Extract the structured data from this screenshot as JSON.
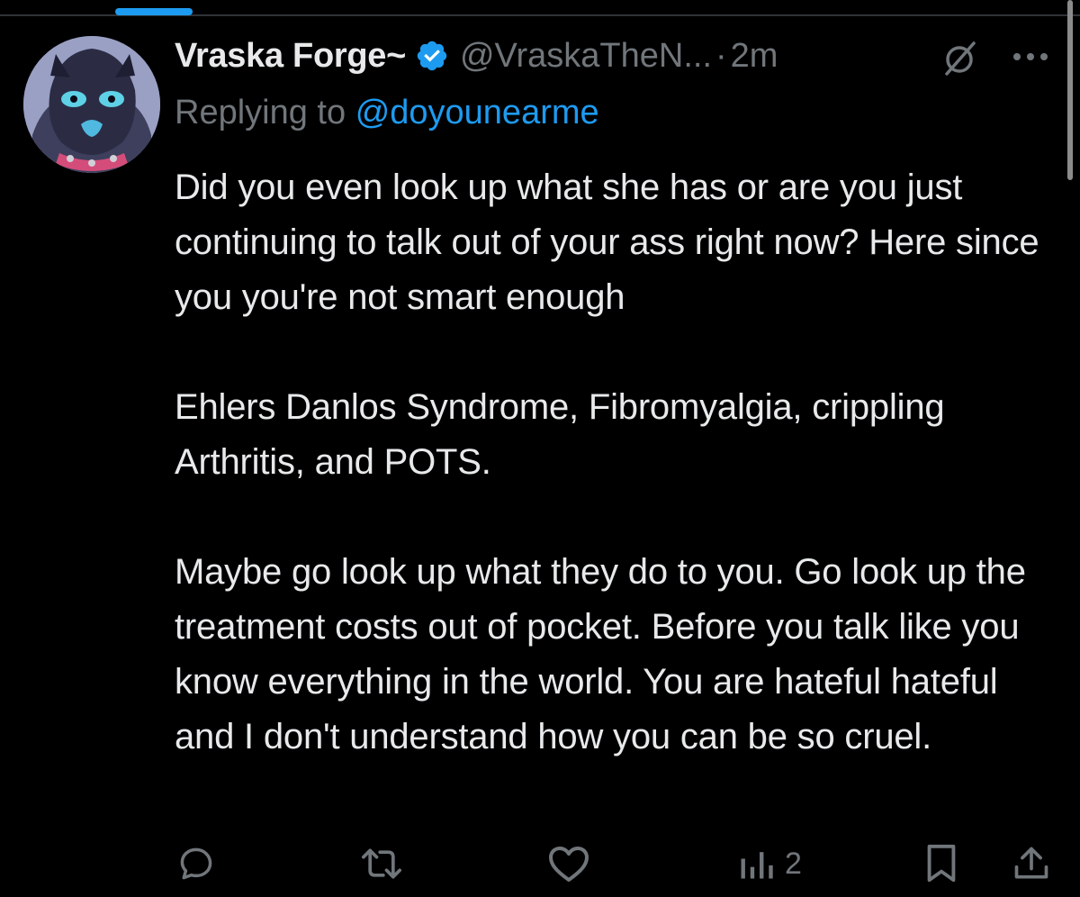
{
  "tweet": {
    "author": {
      "display_name": "Vraska Forge~",
      "handle": "@VraskaTheN...",
      "verified": true,
      "avatar": "cartoon-character-avatar"
    },
    "separator": "·",
    "timestamp": "2m",
    "replying_to_prefix": "Replying to",
    "replying_to_handle": "@doyounearme",
    "paragraphs": [
      "Did you even look up what she has or are you just continuing to talk out of your ass right now? Here since you you're not smart enough",
      "Ehlers Danlos Syndrome, Fibromyalgia, crippling Arthritis, and POTS.",
      "Maybe go look up what they do to you. Go look up the treatment costs out of pocket. Before you talk like you know everything in the world. You are hateful hateful and I don't understand how you can be so cruel."
    ],
    "actions": {
      "reply_icon": "reply-icon",
      "retweet_icon": "retweet-icon",
      "like_icon": "heart-icon",
      "views_icon": "views-icon",
      "views_count": "2",
      "bookmark_icon": "bookmark-icon",
      "share_icon": "share-icon"
    }
  },
  "header_icons": {
    "grok": "grok-icon",
    "more": "more-icon"
  },
  "colors": {
    "background": "#000000",
    "text_primary": "#e7e9ea",
    "text_secondary": "#71767b",
    "accent": "#1d9bf0"
  }
}
